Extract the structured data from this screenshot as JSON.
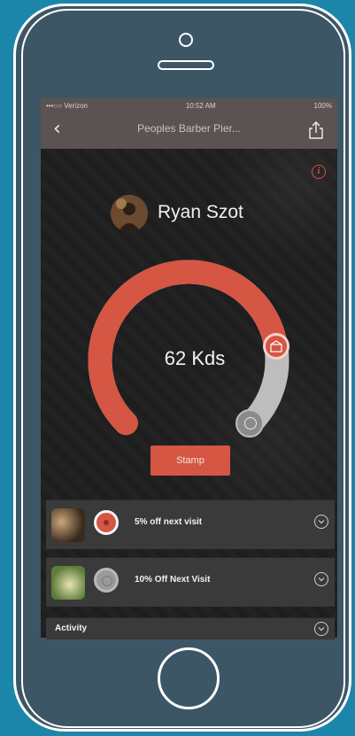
{
  "status_bar": {
    "carrier": "•••○○ Verizon",
    "time": "10:52 AM",
    "battery": "100%"
  },
  "nav": {
    "back_icon": "back-chevron-icon",
    "title": "Peoples Barber Pier...",
    "share_icon": "share-icon"
  },
  "profile": {
    "name": "Ryan Szot",
    "info_icon": "info-icon"
  },
  "gauge": {
    "points_label": "62 Kds",
    "progress_fraction": 0.8,
    "accent_color": "#d55643",
    "track_color": "#bdbdbd"
  },
  "stamp_button": {
    "label": "Stamp"
  },
  "rewards": [
    {
      "label": "5% off next visit",
      "badge_color": "#d55643",
      "active": true
    },
    {
      "label": "10% Off Next Visit",
      "badge_color": "#9a9a9a",
      "active": false
    }
  ],
  "activity": {
    "label": "Activity"
  }
}
